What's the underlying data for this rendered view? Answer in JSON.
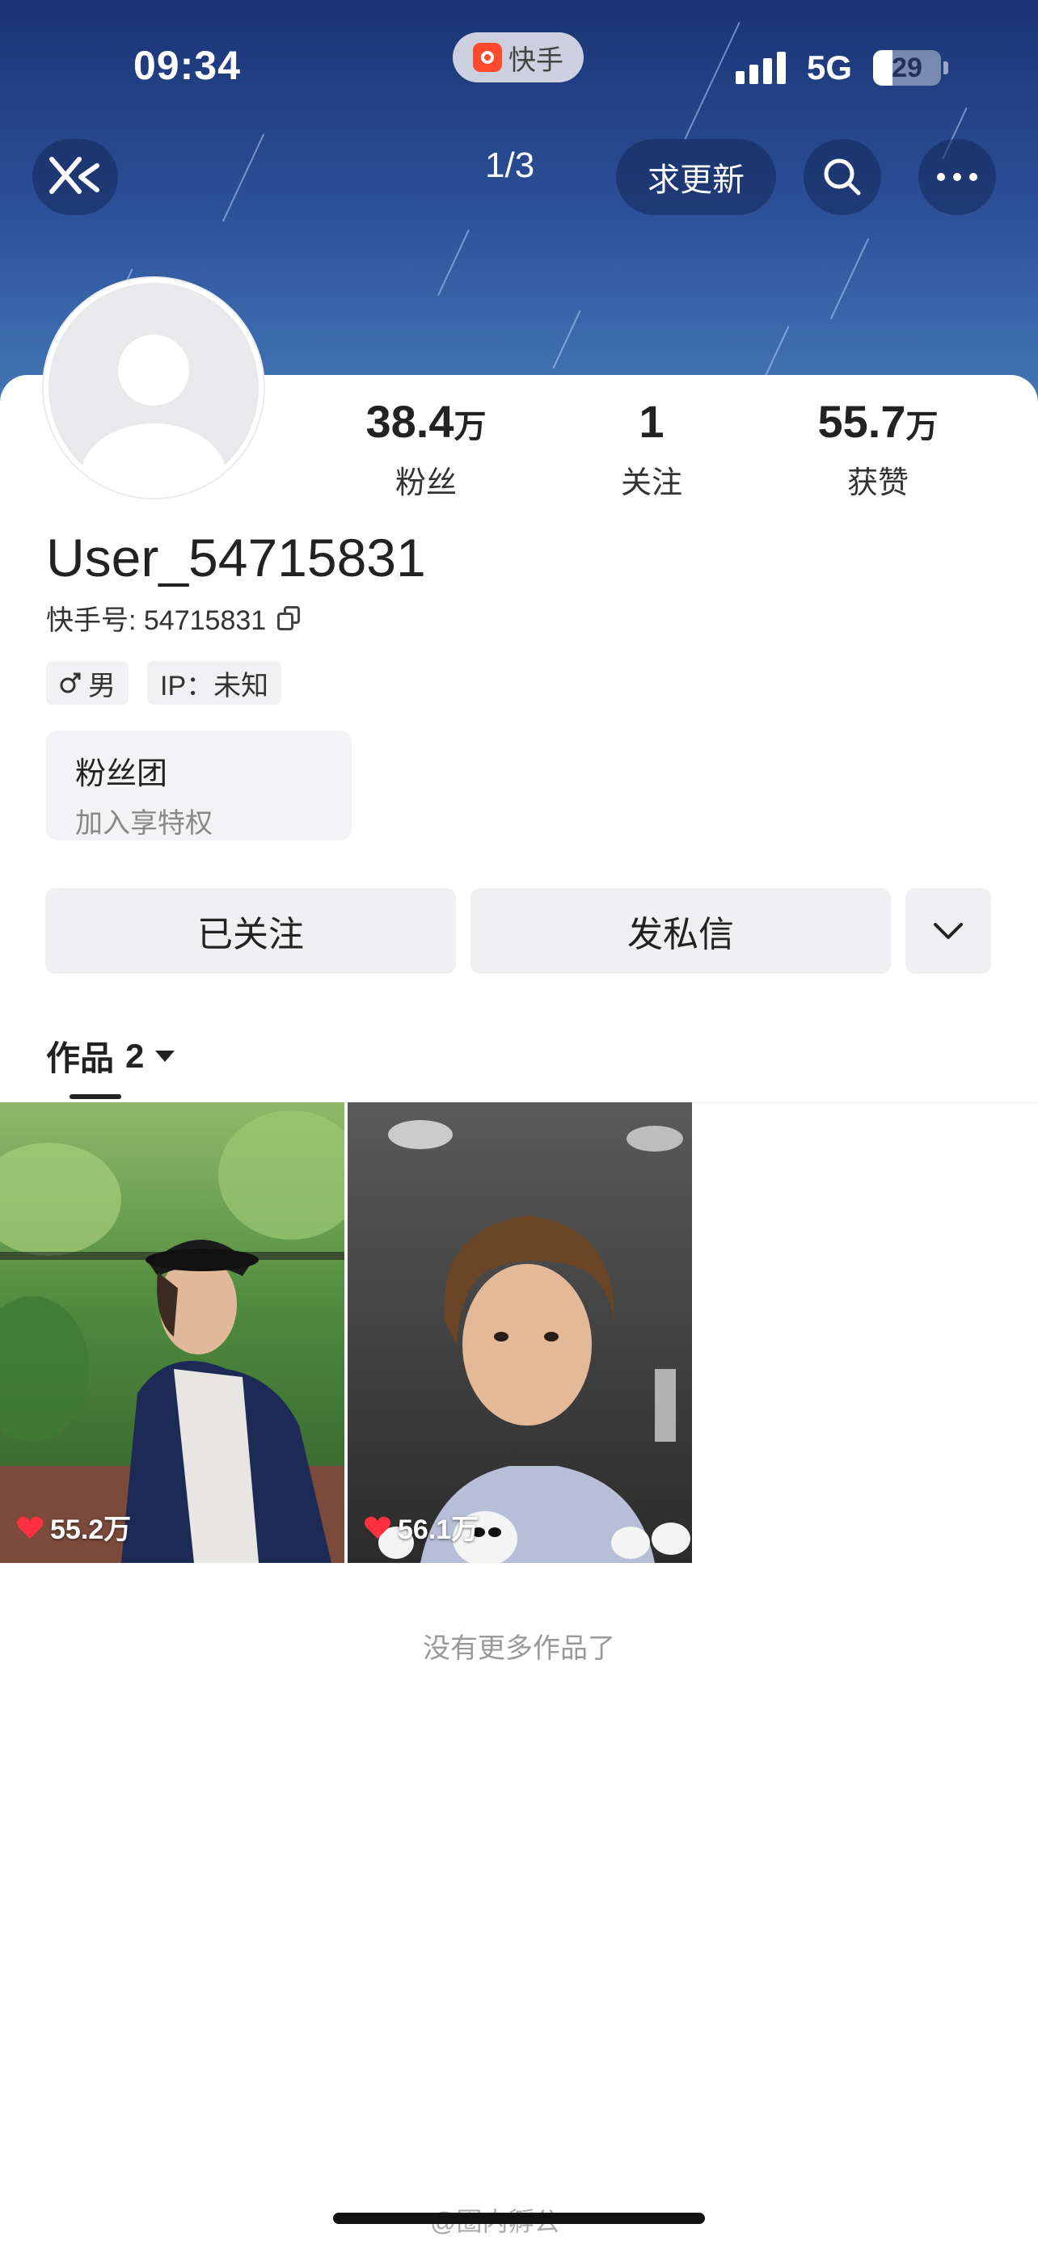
{
  "status": {
    "time": "09:34",
    "network": "5G",
    "battery": "29",
    "battery_level": 0.29
  },
  "app_badge": {
    "label": "快手"
  },
  "nav": {
    "page_indicator": "1/3",
    "update_label": "求更新"
  },
  "profile": {
    "stats": [
      {
        "value": "38.4",
        "unit": "万",
        "label": "粉丝"
      },
      {
        "value": "1",
        "unit": "",
        "label": "关注"
      },
      {
        "value": "55.7",
        "unit": "万",
        "label": "获赞"
      }
    ],
    "username": "User_54715831",
    "ks_id": "快手号: 54715831",
    "tags": {
      "gender": "男",
      "ip": "IP：未知"
    },
    "fan_club": {
      "title": "粉丝团",
      "subtitle": "加入享特权"
    }
  },
  "actions": {
    "followed": "已关注",
    "message": "发私信"
  },
  "works": {
    "tab_label": "作品",
    "count": "2",
    "items": [
      {
        "likes": "55.2万"
      },
      {
        "likes": "56.1万"
      }
    ],
    "no_more": "没有更多作品了"
  },
  "watermark": "@圈内孵公",
  "colors": {
    "header_top": "#1b3473",
    "header_bottom": "#4878b5",
    "like_red": "#ff3040"
  }
}
